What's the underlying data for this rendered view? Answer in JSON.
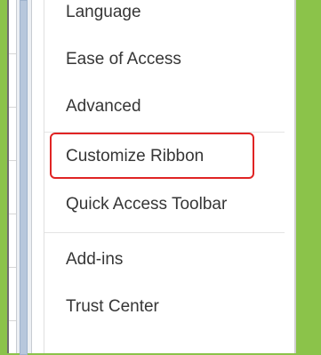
{
  "menu": {
    "items": [
      {
        "label": "Language"
      },
      {
        "label": "Ease of Access"
      },
      {
        "label": "Advanced"
      },
      {
        "label": "Customize Ribbon"
      },
      {
        "label": "Quick Access Toolbar"
      },
      {
        "label": "Add-ins"
      },
      {
        "label": "Trust Center"
      }
    ],
    "highlighted_item": "Customize Ribbon"
  },
  "colors": {
    "frame_green": "#8bc34a",
    "highlight_red": "#e02424",
    "text": "#363636"
  }
}
